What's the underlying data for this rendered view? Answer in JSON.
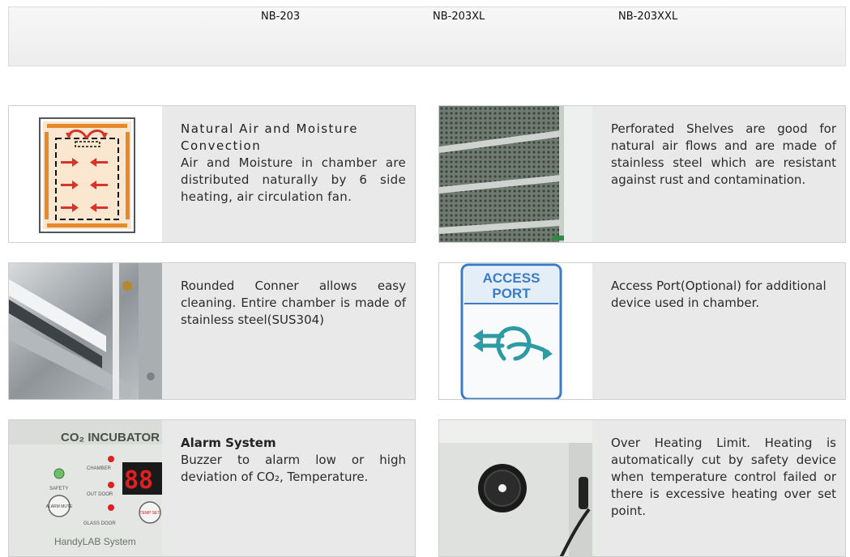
{
  "models": [
    "NB-203",
    "NB-203XL",
    "NB-203XXL"
  ],
  "features": {
    "convection": {
      "title": "Natural Air and Moisture Convection",
      "body": "Air and Moisture in chamber are distributed naturally by 6 side heating, air circulation fan."
    },
    "shelves": {
      "body": "Perforated Shelves are good for natural air flows and are made of stainless steel which are resistant against rust and contamination."
    },
    "corner": {
      "body": "Rounded Conner allows easy cleaning. Entire chamber is made of stainless steel(SUS304)"
    },
    "access_port": {
      "icon_text_line1": "ACCESS",
      "icon_text_line2": "PORT",
      "body": "Access Port(Optional) for additional device used in chamber."
    },
    "alarm": {
      "title": "Alarm System",
      "body": "Buzzer to alarm low or high deviation of CO₂, Temperature.",
      "panel_title": "CO₂ INCUBATOR",
      "panel_labels": [
        "CHAMBER",
        "OUT DOOR",
        "GLASS DOOR",
        "SAFETY"
      ],
      "alarm_button": "ALARM MUTE",
      "temp_button": "TEMP SET",
      "display_value": "88",
      "brand": "HandyLAB System"
    },
    "overheat": {
      "body": "Over Heating Limit. Heating is automatically cut by safety device when temperature control failed or there is excessive heating over set point."
    }
  },
  "colors": {
    "accent_orange": "#e5892a",
    "arrow_red": "#d9342b",
    "access_blue": "#3b7cc4",
    "teal": "#2e9aa3",
    "display_red": "#e0201f"
  }
}
